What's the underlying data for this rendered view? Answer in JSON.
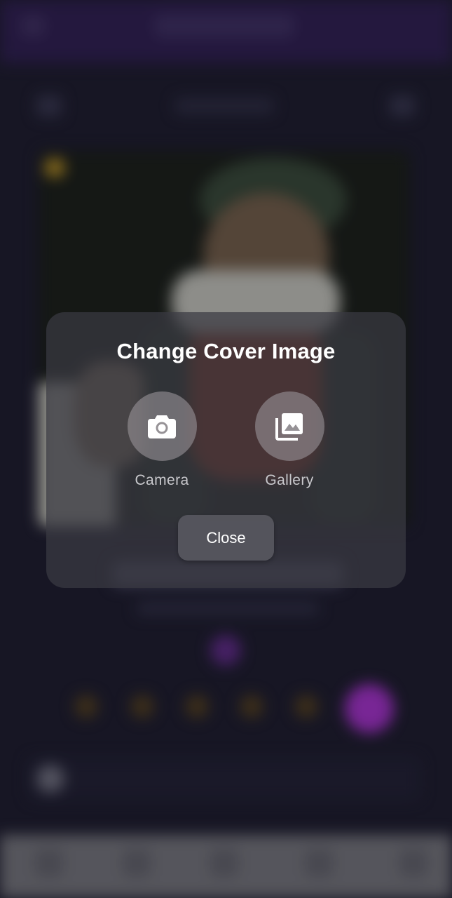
{
  "dialog": {
    "title": "Change Cover Image",
    "options": [
      {
        "label": "Camera",
        "icon": "camera-icon"
      },
      {
        "label": "Gallery",
        "icon": "gallery-icon"
      }
    ],
    "close_label": "Close"
  },
  "colors": {
    "dialog_background": "#3a3a42",
    "option_circle": "#969296",
    "close_button": "#56565e",
    "app_bar": "#2c1c4c",
    "accent": "#9c2fc0"
  }
}
